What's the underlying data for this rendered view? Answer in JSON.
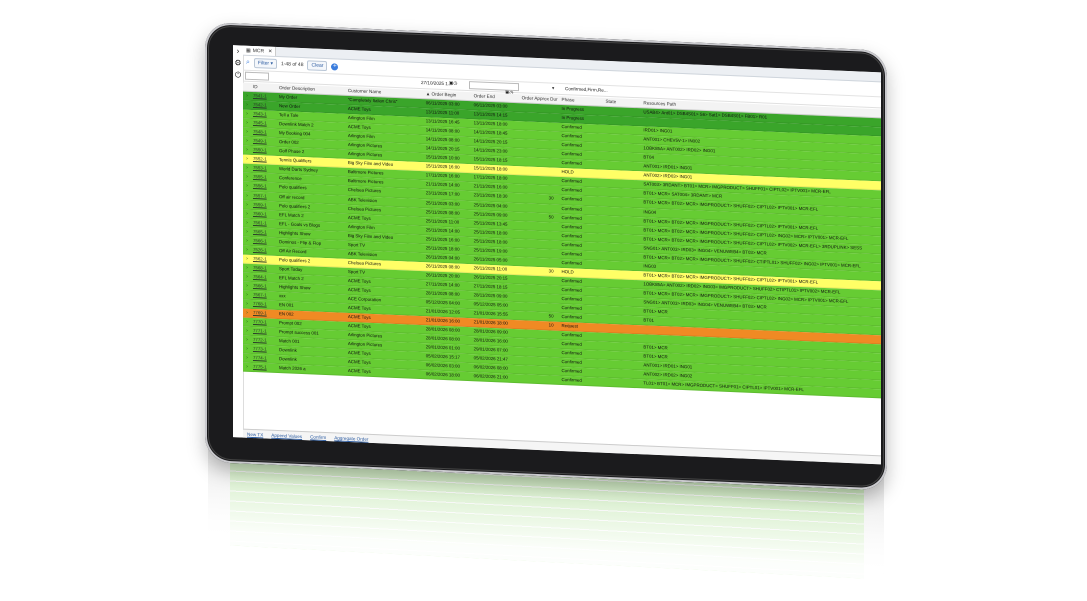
{
  "tab": {
    "label": "MCR",
    "close": "✕"
  },
  "toolbar": {
    "filter_label": "Filter",
    "count_label": "1-48 of 48",
    "clear_label": "Clear",
    "add_label": "+"
  },
  "filters": {
    "date_value": "27/10/2025 1...",
    "phase_value": "Confirmed,Firm,Re..."
  },
  "columns": [
    "ID",
    "Order Description",
    "Customer Name",
    "▲ Order Begin",
    "Order End",
    "Order Approx Dur",
    "Phase",
    "State",
    "Resources Path"
  ],
  "colors": {
    "green": "#66cc33",
    "dark_green": "#3aa52a",
    "yellow": "#ffff66",
    "orange": "#f08a24"
  },
  "rows": [
    {
      "id": "7541-1",
      "desc": "My Order",
      "customer": "\"Completely Italian Chris\"",
      "begin": "06/11/2025 03:00",
      "end": "06/11/2025 03:00",
      "dur": "",
      "phase": "In Progress",
      "state": "",
      "path": "USAB4> Ant01> DSB4S01> S6> Sat1> DSB4S01> FB01> R01"
    },
    {
      "id": "7542-1",
      "desc": "New Order",
      "customer": "ACME Toys",
      "begin": "13/11/2025 11:00",
      "end": "13/11/2025 14:15",
      "dur": "",
      "phase": "In Progress",
      "state": "",
      "path": ""
    },
    {
      "id": "7543-1",
      "desc": "Tell a Tale",
      "customer": "Arlington Film",
      "begin": "13/11/2025 16:45",
      "end": "13/11/2025 18:00",
      "dur": "",
      "phase": "Confirmed",
      "state": "",
      "path": "IRD01> ING01"
    },
    {
      "id": "7545-1",
      "desc": "Downlink Match 2",
      "customer": "ACME Toys",
      "begin": "14/11/2025 08:00",
      "end": "14/11/2025 18:45",
      "dur": "",
      "phase": "Confirmed",
      "state": "",
      "path": "ANT001> CHEV5V-1> IN002"
    },
    {
      "id": "7548-1",
      "desc": "My Booking 004",
      "customer": "Arlington Film",
      "begin": "14/11/2025 08:00",
      "end": "14/11/2025 20:15",
      "dur": "",
      "phase": "Confirmed",
      "state": "",
      "path": "1OBK85A> ANT002> IRD02> ING01"
    },
    {
      "id": "7549-1",
      "desc": "Order 002",
      "customer": "Arlington Pictures",
      "begin": "14/11/2025 20:15",
      "end": "14/11/2025 23:00",
      "dur": "",
      "phase": "Confirmed",
      "state": "",
      "path": "BT04"
    },
    {
      "id": "7550-1",
      "desc": "Golf Phase 2",
      "customer": "Arlington Pictures",
      "begin": "15/11/2025 10:00",
      "end": "15/11/2025 18:15",
      "dur": "",
      "phase": "Confirmed",
      "state": "",
      "path": "ANT001> IRD01> ING01"
    },
    {
      "id": "7552-1",
      "desc": "Tennis Qualifiers",
      "customer": "Big Sky Film and Video",
      "begin": "15/11/2025 16:00",
      "end": "15/11/2025 18:00",
      "dur": "",
      "phase": "HOLD",
      "state": "",
      "path": "ANT002> IRD03> ING01"
    },
    {
      "id": "7553-1",
      "desc": "World Darts Sydney",
      "customer": "Baltimore Pictures",
      "begin": "17/11/2025 16:00",
      "end": "17/11/2025 18:00",
      "dur": "",
      "phase": "Confirmed",
      "state": "",
      "path": "SAT003> 3RDANT> BT01> MCR> IMGPRODUCT> SHUFF01> CIPTL02> IPTV001> MCR-EFL"
    },
    {
      "id": "7555-1",
      "desc": "Conference",
      "customer": "Baltimore Pictures",
      "begin": "21/11/2025 14:00",
      "end": "21/11/2025 16:00",
      "dur": "",
      "phase": "Confirmed",
      "state": "",
      "path": "BT01> MCR> SAT004> 3RDANT> MCR"
    },
    {
      "id": "7556-1",
      "desc": "Polo qualifiers",
      "customer": "Chelsea Pictures",
      "begin": "23/11/2025 17:00",
      "end": "23/11/2025 18:30",
      "dur": "30",
      "phase": "Confirmed",
      "state": "",
      "path": "BT01> MCR> BT02> MCR> IMGPRODUCT> SHUFF02> CIPTL02> IPTV001> MCR-EFL"
    },
    {
      "id": "7557-1",
      "desc": "Off air record",
      "customer": "ABK Television",
      "begin": "25/11/2025 03:00",
      "end": "25/11/2025 04:00",
      "dur": "",
      "phase": "Confirmed",
      "state": "",
      "path": "ING04"
    },
    {
      "id": "7559-1",
      "desc": "Polo qualifiers 2",
      "customer": "Chelsea Pictures",
      "begin": "25/11/2025 08:00",
      "end": "25/11/2025 09:00",
      "dur": "50",
      "phase": "Confirmed",
      "state": "",
      "path": "BT01> MCR> BT02> MCR> IMGPRODUCT> SHUFF02> CIPTL02> IPTV001> MCR-EFL"
    },
    {
      "id": "7560-1",
      "desc": "EFL Match 2",
      "customer": "ACME Toys",
      "begin": "25/11/2025 11:00",
      "end": "25/11/2025 13:45",
      "dur": "",
      "phase": "Confirmed",
      "state": "",
      "path": "BT01> MCR> BT02> MCR> IMGPRODUCT> SHUFF02> CIPTL02> ING02> MCR> IPTV001> MCR-EFL"
    },
    {
      "id": "7561-1",
      "desc": "EFL - Goals vs Blogs",
      "customer": "Arlington Film",
      "begin": "25/11/2025 14:00",
      "end": "25/11/2025 18:00",
      "dur": "",
      "phase": "Confirmed",
      "state": "",
      "path": "BT01> MCR> BT02> MCR> IMGPRODUCT> SHUFF02> CIPTL02> IPTV002> MCR-EFL> 3RDUPLINK> SESS"
    },
    {
      "id": "7565-1",
      "desc": "Highlights Show",
      "customer": "Big Sky Film and Video",
      "begin": "25/11/2025 16:00",
      "end": "25/11/2025 18:00",
      "dur": "",
      "phase": "Confirmed",
      "state": "",
      "path": "SNG01> ANT003> IRD03> ING04> VENUWEB4> BT03> MCR"
    },
    {
      "id": "7566-1",
      "desc": "Dominos - Flip & Flop",
      "customer": "Sport TV",
      "begin": "25/11/2025 18:00",
      "end": "25/11/2025 19:00",
      "dur": "",
      "phase": "Confirmed",
      "state": "",
      "path": "BT01> MCR> BT02> MCR> IMGPRODUCT> SHUFF02> CTIPTL01> SHUFF02> ING02> IPTV001> MCR-EFL"
    },
    {
      "id": "7526-1",
      "desc": "Off Air Record",
      "customer": "ABK Television",
      "begin": "26/11/2025 04:00",
      "end": "26/11/2025 05:00",
      "dur": "",
      "phase": "Confirmed",
      "state": "",
      "path": "ING03"
    },
    {
      "id": "7562-1",
      "desc": "Polo qualifiers 2",
      "customer": "Chelsea Pictures",
      "begin": "26/11/2025 08:00",
      "end": "26/11/2025 11:00",
      "dur": "30",
      "phase": "HOLD",
      "state": "",
      "path": "BT01> MCR> BT02> MCR> IMGPRODUCT> SHUFF02> CIPTL02> IPTV001> MCR-EFL"
    },
    {
      "id": "7568-1",
      "desc": "Sport Today",
      "customer": "Sport TV",
      "begin": "26/11/2025 20:00",
      "end": "26/11/2025 20:15",
      "dur": "",
      "phase": "Confirmed",
      "state": "",
      "path": "1OBK85A> ANT002> IRD02> ING03> IMGPRODUCT> SHUFF02> CTIPTL01> IPTV002> MCR-EFL"
    },
    {
      "id": "7564-1",
      "desc": "EFL Match 2",
      "customer": "ACME Toys",
      "begin": "27/11/2025 14:00",
      "end": "27/11/2025 18:15",
      "dur": "",
      "phase": "Confirmed",
      "state": "",
      "path": "BT01> MCR> BT02> MCR> IMGPRODUCT> SHUFF02> CIPTL02> ING02> MCR> IPTV001> MCR-EFL"
    },
    {
      "id": "7566-1",
      "desc": "Highlights Show",
      "customer": "ACME Toys",
      "begin": "28/11/2025 08:00",
      "end": "28/11/2025 09:00",
      "dur": "",
      "phase": "Confirmed",
      "state": "",
      "path": "SNG01> ANT003> IRD03> ING04> VENUWEB4> BT03> MCR"
    },
    {
      "id": "7567-1",
      "desc": "xxx",
      "customer": "ACE Corporation",
      "begin": "05/12/2025 04:00",
      "end": "05/12/2025 05:00",
      "dur": "",
      "phase": "Confirmed",
      "state": "",
      "path": "BT01> MCR"
    },
    {
      "id": "7768-1",
      "desc": "EN 001",
      "customer": "ACME Toys",
      "begin": "21/01/2026 12:05",
      "end": "21/01/2026 15:55",
      "dur": "50",
      "phase": "Confirmed",
      "state": "",
      "path": "BT01"
    },
    {
      "id": "7769-1",
      "desc": "EN 002",
      "customer": "ACME Toys",
      "begin": "21/01/2026 16:00",
      "end": "21/01/2026 18:00",
      "dur": "10",
      "phase": "Request",
      "state": "",
      "path": ""
    },
    {
      "id": "7770-1",
      "desc": "Prompt 002",
      "customer": "ACME Toys",
      "begin": "28/01/2026 08:00",
      "end": "28/01/2026 09:00",
      "dur": "",
      "phase": "Confirmed",
      "state": "",
      "path": ""
    },
    {
      "id": "7771-1",
      "desc": "Prompt success 001",
      "customer": "Arlington Pictures",
      "begin": "28/01/2026 08:00",
      "end": "28/01/2026 16:00",
      "dur": "",
      "phase": "Confirmed",
      "state": "",
      "path": "BT01> MCR"
    },
    {
      "id": "7772-1",
      "desc": "Match 001",
      "customer": "Arlington Pictures",
      "begin": "29/01/2026 01:00",
      "end": "29/01/2026 07:00",
      "dur": "",
      "phase": "Confirmed",
      "state": "",
      "path": "BT01> MCR"
    },
    {
      "id": "7773-1",
      "desc": "Downlink",
      "customer": "ACME Toys",
      "begin": "05/02/2026 15:17",
      "end": "05/02/2026 21:47",
      "dur": "",
      "phase": "Confirmed",
      "state": "",
      "path": "ANT001> IRD01> ING01"
    },
    {
      "id": "7774-1",
      "desc": "Downlink",
      "customer": "ACME Toys",
      "begin": "06/02/2026 03:00",
      "end": "06/02/2026 08:00",
      "dur": "",
      "phase": "Confirmed",
      "state": "",
      "path": "ANT002> IRD02> ING02"
    },
    {
      "id": "7775-1",
      "desc": "Match 2026 a",
      "customer": "ACME Toys",
      "begin": "06/02/2026 18:00",
      "end": "06/02/2026 21:00",
      "dur": "",
      "phase": "Confirmed",
      "state": "",
      "path": "TL01> BT01> MCR> IMGPRODUCT> SHUFF01> CIPTL01> IPTV001> MCR-EFL"
    }
  ],
  "bottom_links": [
    "New TX",
    "Append Values",
    "Confirm",
    "Aggregate Order"
  ]
}
